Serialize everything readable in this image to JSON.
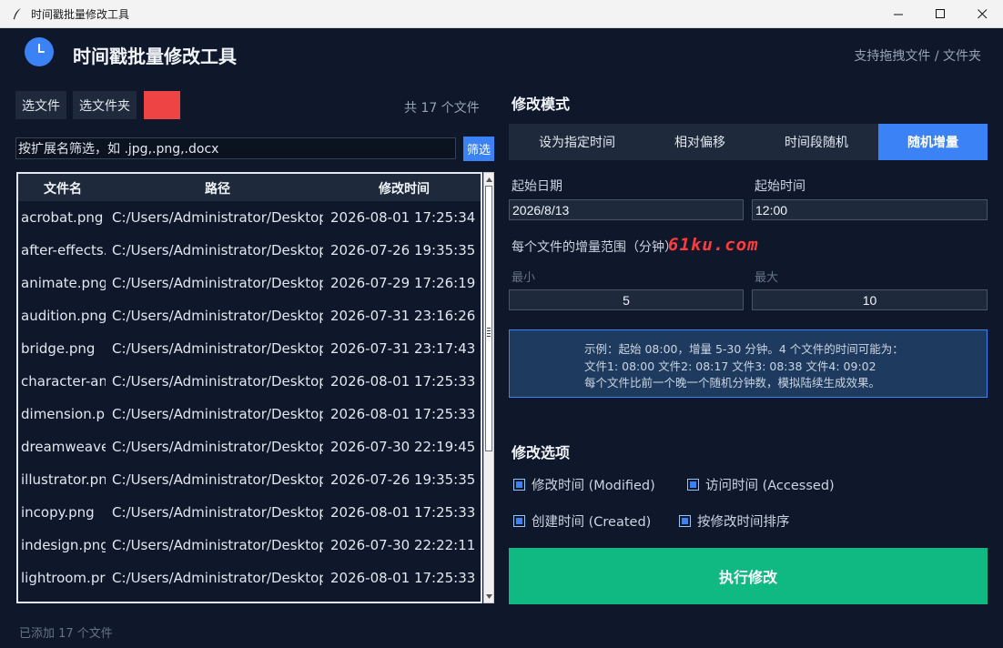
{
  "window": {
    "title": "时间戳批量修改工具",
    "icon": "feather-pen-icon",
    "controls": [
      "minimize-icon",
      "maximize-icon",
      "close-icon"
    ]
  },
  "header": {
    "icon": "clock-icon",
    "title": "时间戳批量修改工具",
    "hint": "支持拖拽文件 / 文件夹"
  },
  "left": {
    "select_file_label": "选文件",
    "select_folder_label": "选文件夹",
    "clear_button_color": "#ef4444",
    "file_count": "共 17 个文件",
    "filter": {
      "value": "按扩展名筛选，如 .jpg,.png,.docx",
      "button": "筛选"
    },
    "table": {
      "columns": [
        "文件名",
        "路径",
        "修改时间"
      ],
      "rows": [
        [
          "acrobat.png",
          "C:/Users/Administrator/Desktop",
          "2026-08-01 17:25:34"
        ],
        [
          "after-effects.",
          "C:/Users/Administrator/Desktop",
          "2026-07-26 19:35:35"
        ],
        [
          "animate.png",
          "C:/Users/Administrator/Desktop",
          "2026-07-29 17:26:19"
        ],
        [
          "audition.png",
          "C:/Users/Administrator/Desktop",
          "2026-07-31 23:16:26"
        ],
        [
          "bridge.png",
          "C:/Users/Administrator/Desktop",
          "2026-07-31 23:17:43"
        ],
        [
          "character-an",
          "C:/Users/Administrator/Desktop",
          "2026-08-01 17:25:33"
        ],
        [
          "dimension.p",
          "C:/Users/Administrator/Desktop",
          "2026-08-01 17:25:33"
        ],
        [
          "dreamweave",
          "C:/Users/Administrator/Desktop",
          "2026-07-30 22:19:45"
        ],
        [
          "illustrator.pn",
          "C:/Users/Administrator/Desktop",
          "2026-07-26 19:35:35"
        ],
        [
          "incopy.png",
          "C:/Users/Administrator/Desktop",
          "2026-08-01 17:25:33"
        ],
        [
          "indesign.png",
          "C:/Users/Administrator/Desktop",
          "2026-07-30 22:22:11"
        ],
        [
          "lightroom.pr",
          "C:/Users/Administrator/Desktop",
          "2026-08-01 17:25:33"
        ]
      ]
    },
    "status": "已添加 17 个文件"
  },
  "right": {
    "mode_title": "修改模式",
    "tabs": [
      "设为指定时间",
      "相对偏移",
      "时间段随机",
      "随机增量"
    ],
    "active_tab": 3,
    "start_date_label": "起始日期",
    "start_date_value": "2026/8/13",
    "start_time_label": "起始时间",
    "start_time_value": "12:00",
    "range_label": "每个文件的增量范围（分钟）",
    "watermark": "61ku.com",
    "min_label": "最小",
    "min_value": "5",
    "max_label": "最大",
    "max_value": "10",
    "example": [
      "示例：起始 08:00，增量 5-30 分钟。4 个文件的时间可能为：",
      "文件1: 08:00  文件2: 08:17  文件3: 08:38  文件4: 09:02",
      "每个文件比前一个晚一个随机分钟数，模拟陆续生成效果。"
    ],
    "options_title": "修改选项",
    "options": [
      {
        "label": "修改时间 (Modified)",
        "checked": true
      },
      {
        "label": "访问时间 (Accessed)",
        "checked": true
      },
      {
        "label": "创建时间 (Created)",
        "checked": true
      },
      {
        "label": "按修改时间排序",
        "checked": true
      }
    ],
    "execute_label": "执行修改",
    "colors": {
      "accent": "#3b82f6",
      "execute": "#10b981",
      "background": "#0f172a",
      "panel": "#1e293b"
    }
  }
}
